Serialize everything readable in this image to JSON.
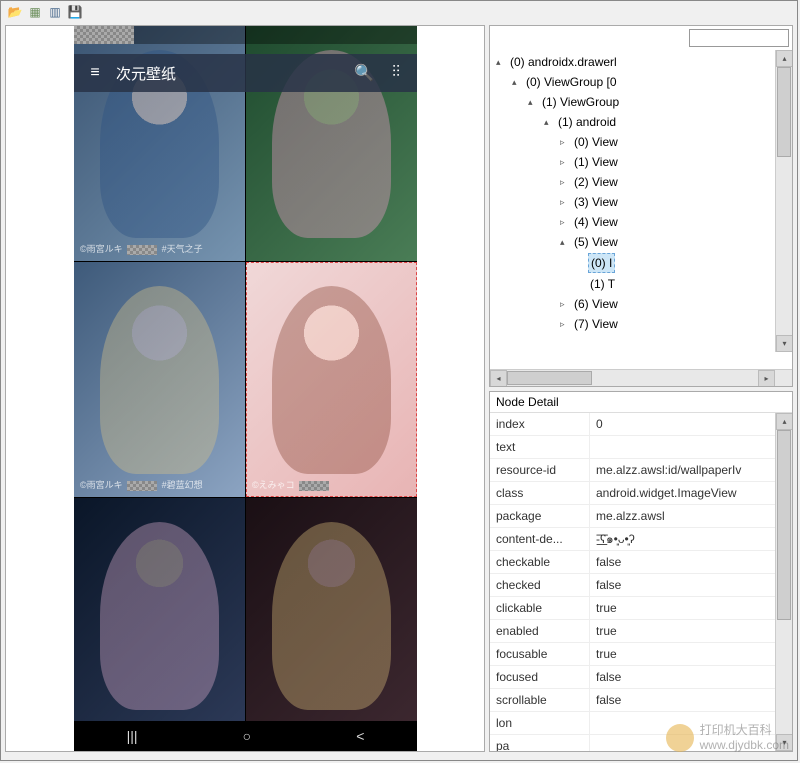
{
  "toolbar": {
    "icons": [
      "folder-open-icon",
      "device-icon",
      "device2-icon",
      "save-icon"
    ]
  },
  "phone": {
    "header": {
      "title": "次元壁纸"
    },
    "nav": {
      "recent": "|||",
      "home": "○",
      "back": "<"
    },
    "wallpapers": {
      "w1_caption_a": "©雨宮ルキ",
      "w1_caption_b": "#天气之子",
      "w3_caption_a": "©雨宮ルキ",
      "w3_caption_b": "#碧蓝幻想",
      "w4_caption_a": "©えみゃコ"
    }
  },
  "tree": {
    "items": [
      {
        "indent": 0,
        "toggle": "▴",
        "label": "(0) androidx.drawerl"
      },
      {
        "indent": 1,
        "toggle": "▴",
        "label": "(0) ViewGroup [0"
      },
      {
        "indent": 2,
        "toggle": "▴",
        "label": "(1) ViewGroup"
      },
      {
        "indent": 3,
        "toggle": "▴",
        "label": "(1) android"
      },
      {
        "indent": 4,
        "toggle": "▹",
        "label": "(0) View"
      },
      {
        "indent": 4,
        "toggle": "▹",
        "label": "(1) View"
      },
      {
        "indent": 4,
        "toggle": "▹",
        "label": "(2) View"
      },
      {
        "indent": 4,
        "toggle": "▹",
        "label": "(3) View"
      },
      {
        "indent": 4,
        "toggle": "▹",
        "label": "(4) View"
      },
      {
        "indent": 4,
        "toggle": "▴",
        "label": "(5) View"
      },
      {
        "indent": 5,
        "toggle": "",
        "label": "(0) I",
        "selected": true
      },
      {
        "indent": 5,
        "toggle": "",
        "label": "(1) T"
      },
      {
        "indent": 4,
        "toggle": "▹",
        "label": "(6) View"
      },
      {
        "indent": 4,
        "toggle": "▹",
        "label": "(7) View"
      }
    ]
  },
  "detail": {
    "title": "Node Detail",
    "rows": [
      {
        "key": "index",
        "val": "0"
      },
      {
        "key": "text",
        "val": ""
      },
      {
        "key": "resource-id",
        "val": "me.alzz.awsl:id/wallpaperIv"
      },
      {
        "key": "class",
        "val": "android.widget.ImageView"
      },
      {
        "key": "package",
        "val": "me.alzz.awsl"
      },
      {
        "key": "content-de...",
        "val": "-͟͟͞͞ʕ๑•͈ᴗ•͈ʔ"
      },
      {
        "key": "checkable",
        "val": "false"
      },
      {
        "key": "checked",
        "val": "false"
      },
      {
        "key": "clickable",
        "val": "true"
      },
      {
        "key": "enabled",
        "val": "true"
      },
      {
        "key": "focusable",
        "val": "true"
      },
      {
        "key": "focused",
        "val": "false"
      },
      {
        "key": "scrollable",
        "val": "false"
      },
      {
        "key": "lon",
        "val": ""
      },
      {
        "key": "pa",
        "val": ""
      }
    ]
  },
  "watermark": {
    "text1": "打印机大百科",
    "text2": "www.djydbk.com"
  }
}
